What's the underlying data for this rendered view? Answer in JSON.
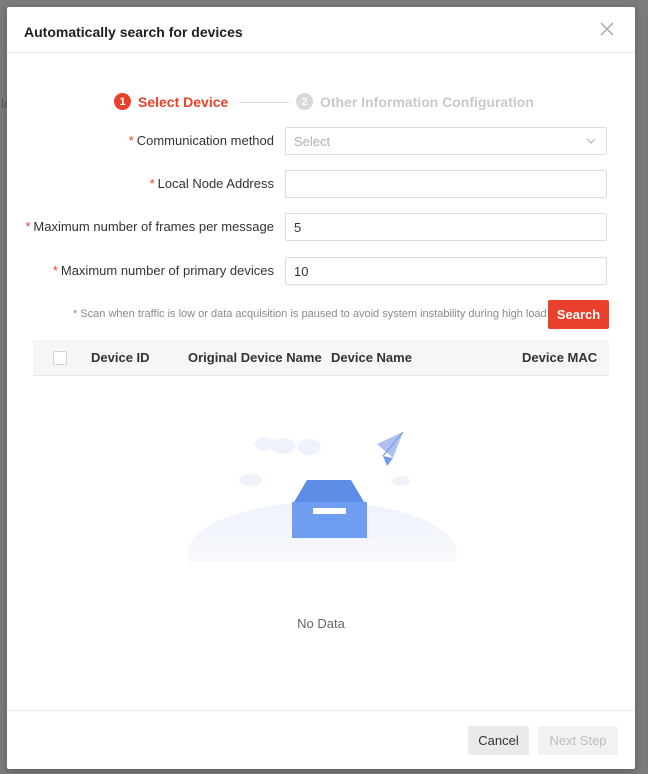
{
  "modal": {
    "title": "Automatically search for devices",
    "close_icon": "close-icon"
  },
  "steps": [
    {
      "number": "1",
      "label": "Select Device",
      "state": "active"
    },
    {
      "number": "2",
      "label": "Other Information Configuration",
      "state": "inactive"
    }
  ],
  "form": {
    "communication_method": {
      "label": "Communication method",
      "placeholder": "Select",
      "value": ""
    },
    "local_node_address": {
      "label": "Local Node Address",
      "value": ""
    },
    "max_frames": {
      "label": "Maximum number of frames per message",
      "value": "5"
    },
    "max_primary_devices": {
      "label": "Maximum number of primary devices",
      "value": "10"
    },
    "required_mark": "*"
  },
  "hint": "* Scan when traffic is low or data acquisition is paused to avoid system instability during high load",
  "search_button": "Search",
  "table": {
    "columns": [
      "Device ID",
      "Original Device Name",
      "Device Name",
      "Device MAC"
    ],
    "rows": [],
    "empty_text": "No Data"
  },
  "footer": {
    "cancel": "Cancel",
    "next": "Next Step"
  },
  "colors": {
    "accent": "#e8402a",
    "empty_box": "#6f9ef0"
  }
}
